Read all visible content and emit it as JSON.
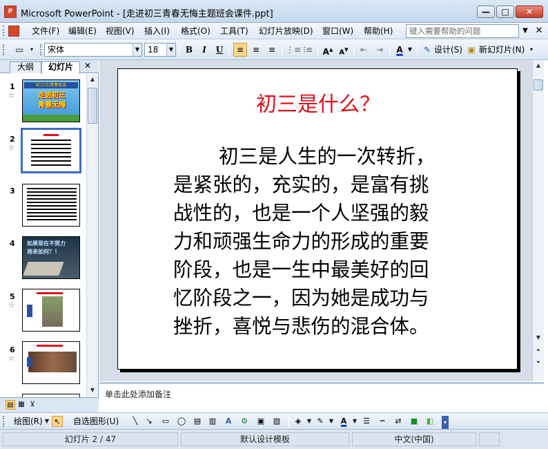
{
  "window": {
    "title": "Microsoft PowerPoint - [走进初三青春无悔主题班会课件.ppt]",
    "minimize": "—",
    "maximize": "□",
    "close": "✕"
  },
  "menu": {
    "items": [
      "文件(F)",
      "编辑(E)",
      "视图(V)",
      "插入(I)",
      "格式(O)",
      "工具(T)",
      "幻灯片放映(D)",
      "窗口(W)",
      "帮助(H)"
    ],
    "help_placeholder": "键入需要帮助的问题"
  },
  "toolbar": {
    "font_name": "宋体",
    "font_size": "18",
    "bold": "B",
    "italic": "I",
    "underline": "U",
    "design_label": "设计(S)",
    "new_slide_label": "新幻灯片(N)"
  },
  "pane": {
    "tab_outline": "大纲",
    "tab_slides": "幻灯片",
    "close": "✕",
    "slides": [
      {
        "number": "1",
        "caption_top": "初三(5)青春班会",
        "caption": "走进初三\n青春无悔"
      },
      {
        "number": "2"
      },
      {
        "number": "3"
      },
      {
        "number": "4",
        "caption": "如果现在不努力\n将来如何？！"
      },
      {
        "number": "5"
      },
      {
        "number": "6"
      }
    ]
  },
  "slide": {
    "title": "初三是什么？",
    "lines": [
      "初三是人生的一次转折，",
      "是紧张的，充实的，是富有挑",
      "战性的，也是一个人坚强的毅",
      "力和顽强生命力的形成的重要",
      "阶段，也是一生中最美好的回",
      "忆阶段之一，因为她是成功与",
      "挫折，喜悦与悲伤的混合体。"
    ]
  },
  "notes": {
    "placeholder": "单击此处添加备注"
  },
  "drawing": {
    "draw_label": "绘图(R)",
    "autoshapes_label": "自选图形(U)"
  },
  "status": {
    "slide_counter": "幻灯片 2 / 47",
    "template": "默认设计模板",
    "language": "中文(中国)"
  },
  "colors": {
    "title_red": "#e0101a",
    "selection_blue": "#3c6cc6",
    "active_button": "#ffd78a"
  }
}
